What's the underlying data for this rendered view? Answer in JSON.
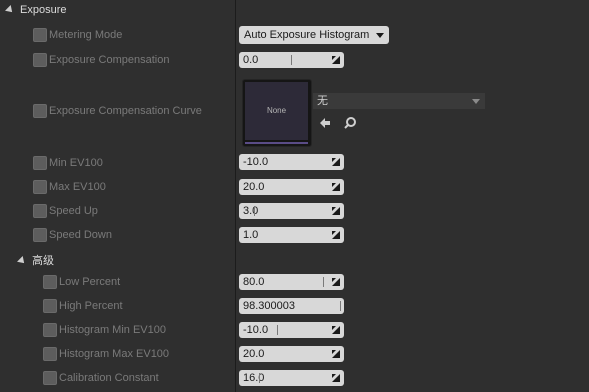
{
  "section": {
    "title": "Exposure"
  },
  "advanced": {
    "title": "高级"
  },
  "metering": {
    "label": "Metering Mode",
    "value": "Auto Exposure Histogram"
  },
  "exposure_comp": {
    "label": "Exposure Compensation",
    "value": "0.0"
  },
  "curve": {
    "label": "Exposure Compensation Curve",
    "asset_thumb": "None",
    "asset_value": "无"
  },
  "min_ev": {
    "label": "Min EV100",
    "value": "-10.0"
  },
  "max_ev": {
    "label": "Max EV100",
    "value": "20.0"
  },
  "speed_up": {
    "label": "Speed Up",
    "value": "3.0"
  },
  "speed_down": {
    "label": "Speed Down",
    "value": "1.0"
  },
  "low_percent": {
    "label": "Low Percent",
    "value": "80.0"
  },
  "high_percent": {
    "label": "High Percent",
    "value": "98.300003"
  },
  "hist_min": {
    "label": "Histogram Min EV100",
    "value": "-10.0"
  },
  "hist_max": {
    "label": "Histogram Max EV100",
    "value": "20.0"
  },
  "calib": {
    "label": "Calibration Constant",
    "value": "16.0"
  },
  "icons": {
    "expand": "expand-arrow-icon",
    "browse": "use-selected-arrow-icon",
    "search": "search-icon",
    "resize": "drag-resize-icon"
  }
}
